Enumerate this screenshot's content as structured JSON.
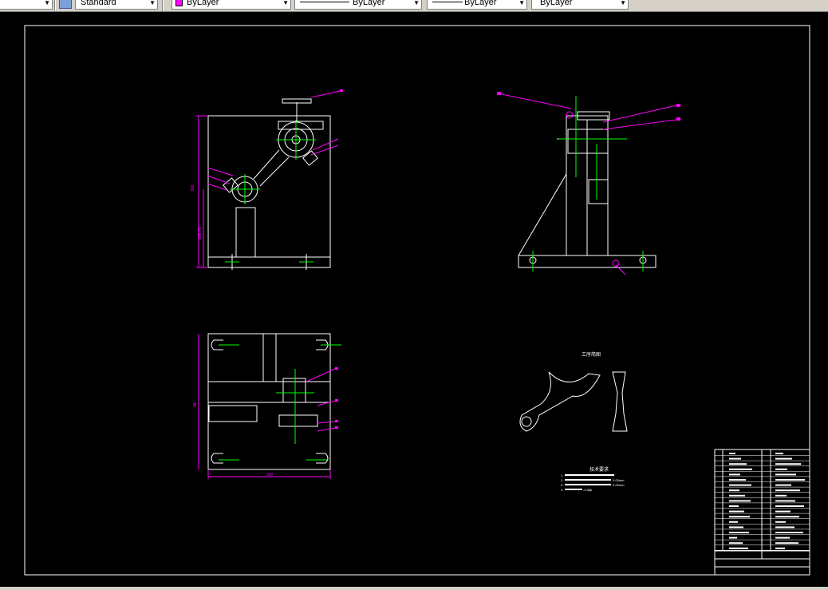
{
  "toolbar": {
    "textstyle_combo": "",
    "dimstyle_combo": "Standard",
    "color_combo": "ByLayer",
    "linetype_combo": "ByLayer",
    "lineweight_combo": "ByLayer",
    "plotstyle_combo": "ByLayer",
    "color_swatch": "#ff00ff"
  },
  "drawing": {
    "colors": {
      "geometry": "#ffffff",
      "centerline": "#00ff00",
      "dimension": "#ff00ff",
      "border": "#ffffff",
      "background": "#000000"
    },
    "front_view": {
      "dim_height": "300",
      "dim_lower": "158.75"
    },
    "top_view": {
      "dim_width": "260",
      "dim_side": "48"
    },
    "side_view": {},
    "workpiece_label": "工序简图",
    "tech_requirements": {
      "title": "技术要求",
      "items": [
        "1.",
        "2.",
        "3.",
        "4."
      ],
      "notes": [
        "0.05mm",
        "0.05mm",
        "-0.5㎜"
      ]
    },
    "title_block": {}
  }
}
